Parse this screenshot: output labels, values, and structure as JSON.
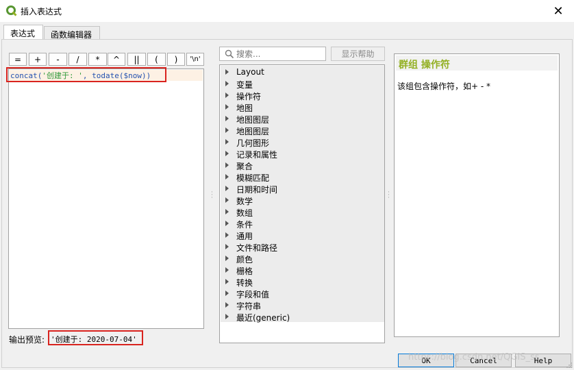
{
  "window": {
    "title": "插入表达式",
    "close_glyph": "✕"
  },
  "tabs": [
    {
      "label": "表达式",
      "active": true
    },
    {
      "label": "函数编辑器",
      "active": false
    }
  ],
  "operators": [
    "=",
    "+",
    "-",
    "/",
    "*",
    "^",
    "||",
    "(",
    ")",
    "'\\n'"
  ],
  "editor": {
    "code_prefix": "concat(",
    "string_literal": "'创建于: '",
    "code_middle": ", todate(",
    "variable": "$now",
    "code_suffix": "))"
  },
  "preview": {
    "label": "输出预览:",
    "value": "'创建于: 2020-07-04'"
  },
  "search": {
    "placeholder": "搜索..."
  },
  "show_help_label": "显示帮助",
  "tree_items": [
    "Layout",
    "变量",
    "操作符",
    "地图",
    "地图图层",
    "地图图层",
    "几何图形",
    "记录和属性",
    "聚合",
    "模糊匹配",
    "日期和时间",
    "数学",
    "数组",
    "条件",
    "通用",
    "文件和路径",
    "颜色",
    "栅格",
    "转换",
    "字段和值",
    "字符串",
    "最近(generic)"
  ],
  "help": {
    "title": "群组 操作符",
    "text": "该组包含操作符，如+ - *"
  },
  "buttons": {
    "ok": "OK",
    "cancel": "Cancel",
    "help": "Help"
  },
  "watermark": "https://blog.csdn.net/QGIS_ss",
  "colors": {
    "accent_green": "#93b023",
    "highlight_red": "#d9231e",
    "string_green": "#2f9a3a",
    "code_blue": "#2452b0"
  }
}
